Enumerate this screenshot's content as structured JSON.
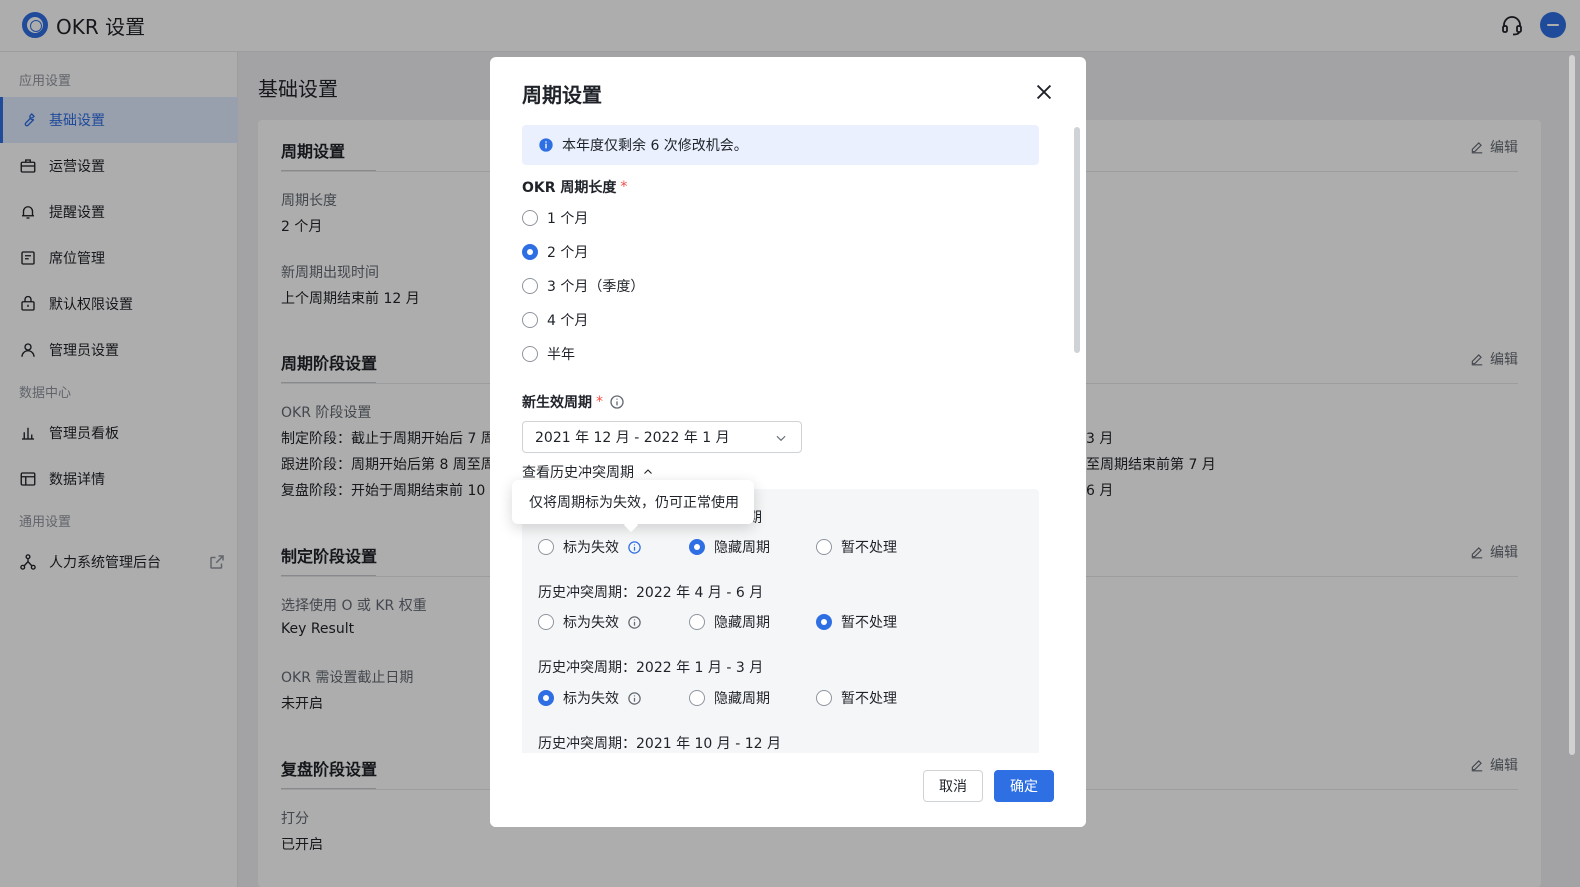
{
  "app": {
    "title": "OKR 设置"
  },
  "sidebar": {
    "groups": [
      {
        "label": "应用设置"
      },
      {
        "label": "数据中心"
      },
      {
        "label": "通用设置"
      }
    ],
    "items": [
      {
        "label": "基础设置",
        "icon": "wrench-icon",
        "active": true
      },
      {
        "label": "运营设置",
        "icon": "briefcase-icon"
      },
      {
        "label": "提醒设置",
        "icon": "bell-icon"
      },
      {
        "label": "席位管理",
        "icon": "seat-icon"
      },
      {
        "label": "默认权限设置",
        "icon": "lock-icon"
      },
      {
        "label": "管理员设置",
        "icon": "user-icon"
      },
      {
        "label": "管理员看板",
        "icon": "bar-chart-icon"
      },
      {
        "label": "数据详情",
        "icon": "table-icon"
      },
      {
        "label": "人力系统管理后台",
        "icon": "org-icon",
        "external": true
      }
    ]
  },
  "main": {
    "page_title": "基础设置",
    "edit_label": "编辑",
    "sections": [
      {
        "title": "周期设置",
        "fields": [
          {
            "label": "周期长度",
            "value": "2 个月"
          },
          {
            "label": "新周期出现时间",
            "value": "上个周期结束前 12 月"
          }
        ]
      },
      {
        "title": "周期阶段设置",
        "label": "OKR 阶段设置",
        "lines": [
          {
            "left": "制定阶段：截止于周期开始后 7 周",
            "right": "3 月"
          },
          {
            "left": "跟进阶段：周期开始后第 8 周至周",
            "right": "至周期结束前第 7 月"
          },
          {
            "left": "复盘阶段：开始于周期结束前 10 天",
            "right": "6 月"
          }
        ]
      },
      {
        "title": "制定阶段设置",
        "fields": [
          {
            "label": "选择使用 O 或 KR 权重",
            "value": "Key Result"
          },
          {
            "label": "OKR 需设置截止日期",
            "value": "未开启"
          }
        ]
      },
      {
        "title": "复盘阶段设置",
        "fields": [
          {
            "label": "打分",
            "value": "已开启"
          }
        ]
      }
    ]
  },
  "modal": {
    "title": "周期设置",
    "alert": "本年度仅剩余 6 次修改机会。",
    "length_label": "OKR 周期长度",
    "required_mark": "*",
    "length_options": [
      {
        "label": "1 个月",
        "checked": false
      },
      {
        "label": "2 个月",
        "checked": true
      },
      {
        "label": "3 个月（季度）",
        "checked": false
      },
      {
        "label": "4 个月",
        "checked": false
      },
      {
        "label": "半年",
        "checked": false
      }
    ],
    "effective_label": "新生效周期",
    "effective_value": "2021 年 12 月 - 2022 年 1 月",
    "history_toggle": "查看历史冲突周期",
    "option_labels": {
      "invalid": "标为失效",
      "hide": "隐藏周期",
      "skip": "暂不处理"
    },
    "conflicts": [
      {
        "title": "",
        "selected": "hide"
      },
      {
        "title": "历史冲突周期：2022 年 4 月 - 6 月",
        "selected": "skip"
      },
      {
        "title": "历史冲突周期：2022 年 1 月 - 3 月",
        "selected": "invalid"
      },
      {
        "title": "历史冲突周期：2021 年 10 月 - 12 月",
        "selected": ""
      }
    ],
    "partial_title_fragment": "期",
    "tooltip": "仅将周期标为失效，仍可正常使用",
    "cancel_label": "取消",
    "ok_label": "确定"
  },
  "colors": {
    "primary": "#2f6fe4",
    "required": "#f54a45",
    "alert_bg": "#eaf0fd"
  }
}
